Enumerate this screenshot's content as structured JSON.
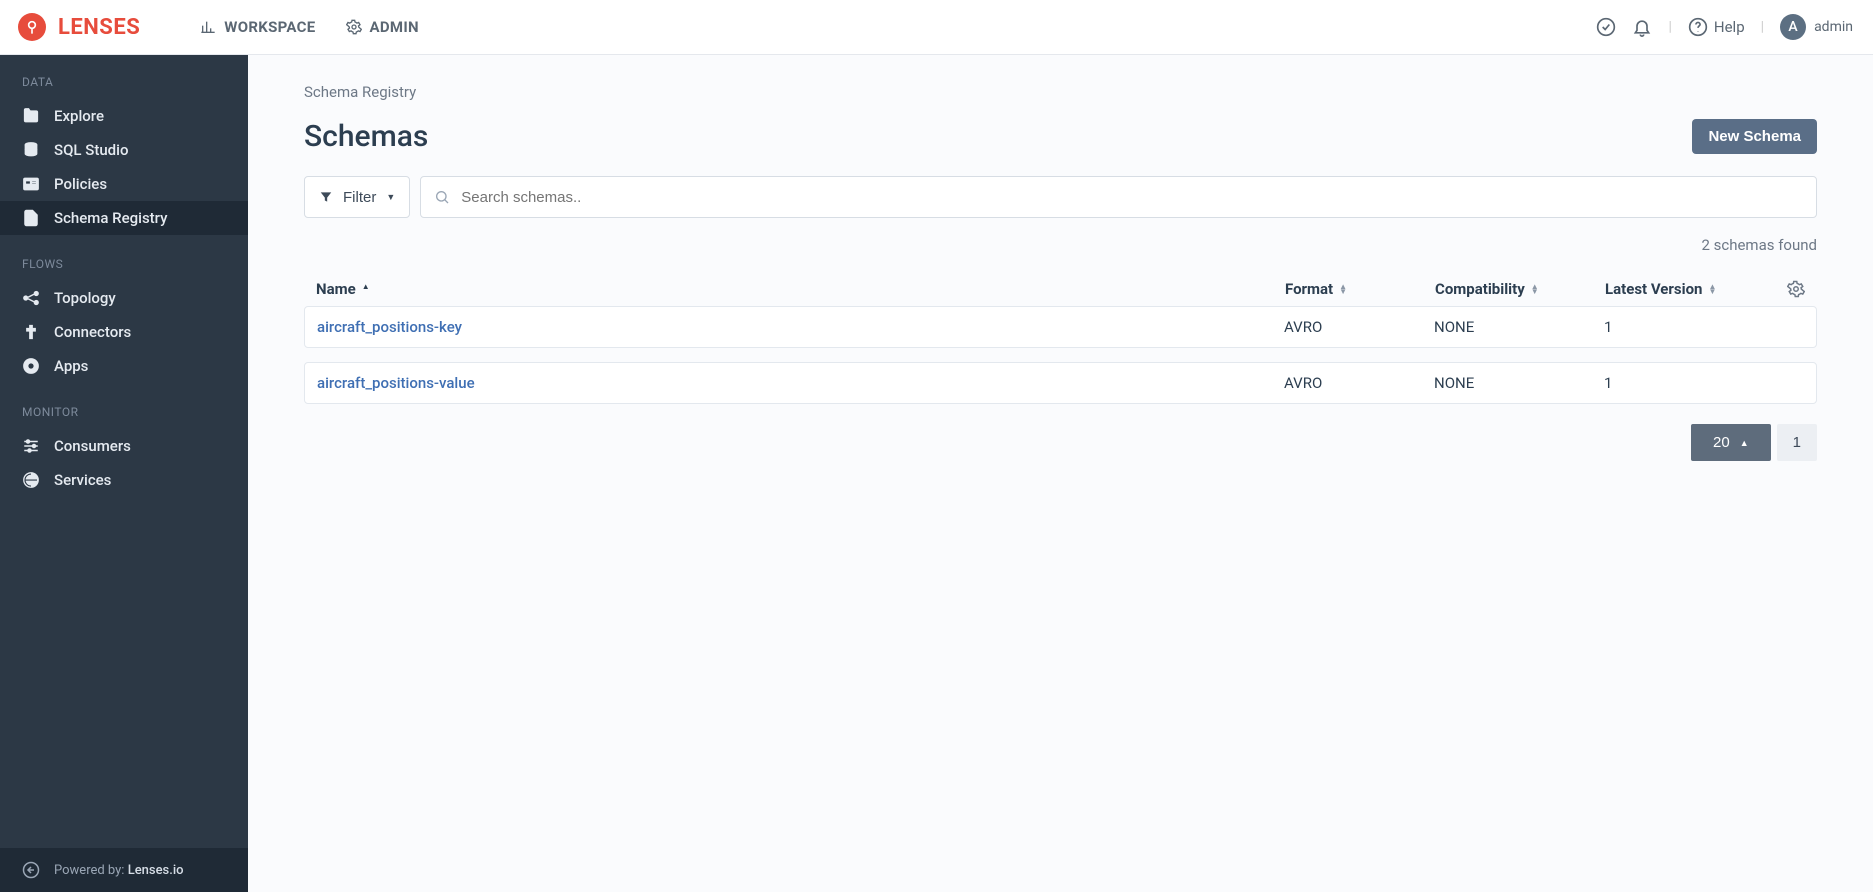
{
  "brand": {
    "name": "LENSES"
  },
  "topnav": {
    "workspace": "WORKSPACE",
    "admin": "ADMIN"
  },
  "header": {
    "help_label": "Help",
    "user_initial": "A",
    "user_name": "admin"
  },
  "sidebar": {
    "sections": {
      "data": {
        "title": "DATA",
        "items": [
          "Explore",
          "SQL Studio",
          "Policies",
          "Schema Registry"
        ],
        "active_index": 3
      },
      "flows": {
        "title": "FLOWS",
        "items": [
          "Topology",
          "Connectors",
          "Apps"
        ]
      },
      "monitor": {
        "title": "MONITOR",
        "items": [
          "Consumers",
          "Services"
        ]
      }
    },
    "footer_prefix": "Powered by: ",
    "footer_link": "Lenses.io"
  },
  "breadcrumb": "Schema Registry",
  "page_title": "Schemas",
  "new_button": "New Schema",
  "filter_label": "Filter",
  "search_placeholder": "Search schemas..",
  "found_label": "2 schemas found",
  "columns": {
    "name": "Name",
    "format": "Format",
    "compat": "Compatibility",
    "version": "Latest Version"
  },
  "rows": [
    {
      "name": "aircraft_positions-key",
      "format": "AVRO",
      "compat": "NONE",
      "version": "1"
    },
    {
      "name": "aircraft_positions-value",
      "format": "AVRO",
      "compat": "NONE",
      "version": "1"
    }
  ],
  "pager": {
    "page_size": "20",
    "page_num": "1"
  }
}
